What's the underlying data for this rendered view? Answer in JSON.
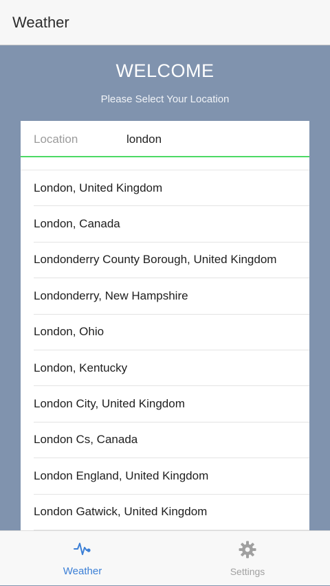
{
  "header": {
    "title": "Weather"
  },
  "main": {
    "welcome": "WELCOME",
    "subtitle": "Please Select Your Location"
  },
  "search": {
    "label": "Location",
    "value": "london"
  },
  "results": [
    "London, United Kingdom",
    "London, Canada",
    "Londonderry County Borough, United Kingdom",
    "Londonderry, New Hampshire",
    "London, Ohio",
    "London, Kentucky",
    "London City, United Kingdom",
    "London Cs, Canada",
    "London England, United Kingdom",
    "London Gatwick, United Kingdom"
  ],
  "tabbar": {
    "tabs": [
      {
        "label": "Weather",
        "icon": "pulse-icon",
        "active": true,
        "color": "#3b7fd6"
      },
      {
        "label": "Settings",
        "icon": "gear-icon",
        "active": false,
        "color": "#a0a0a0"
      }
    ]
  },
  "colors": {
    "background": "#8093ae",
    "accent_underline": "#4cd964",
    "active_tab": "#3b7fd6"
  }
}
